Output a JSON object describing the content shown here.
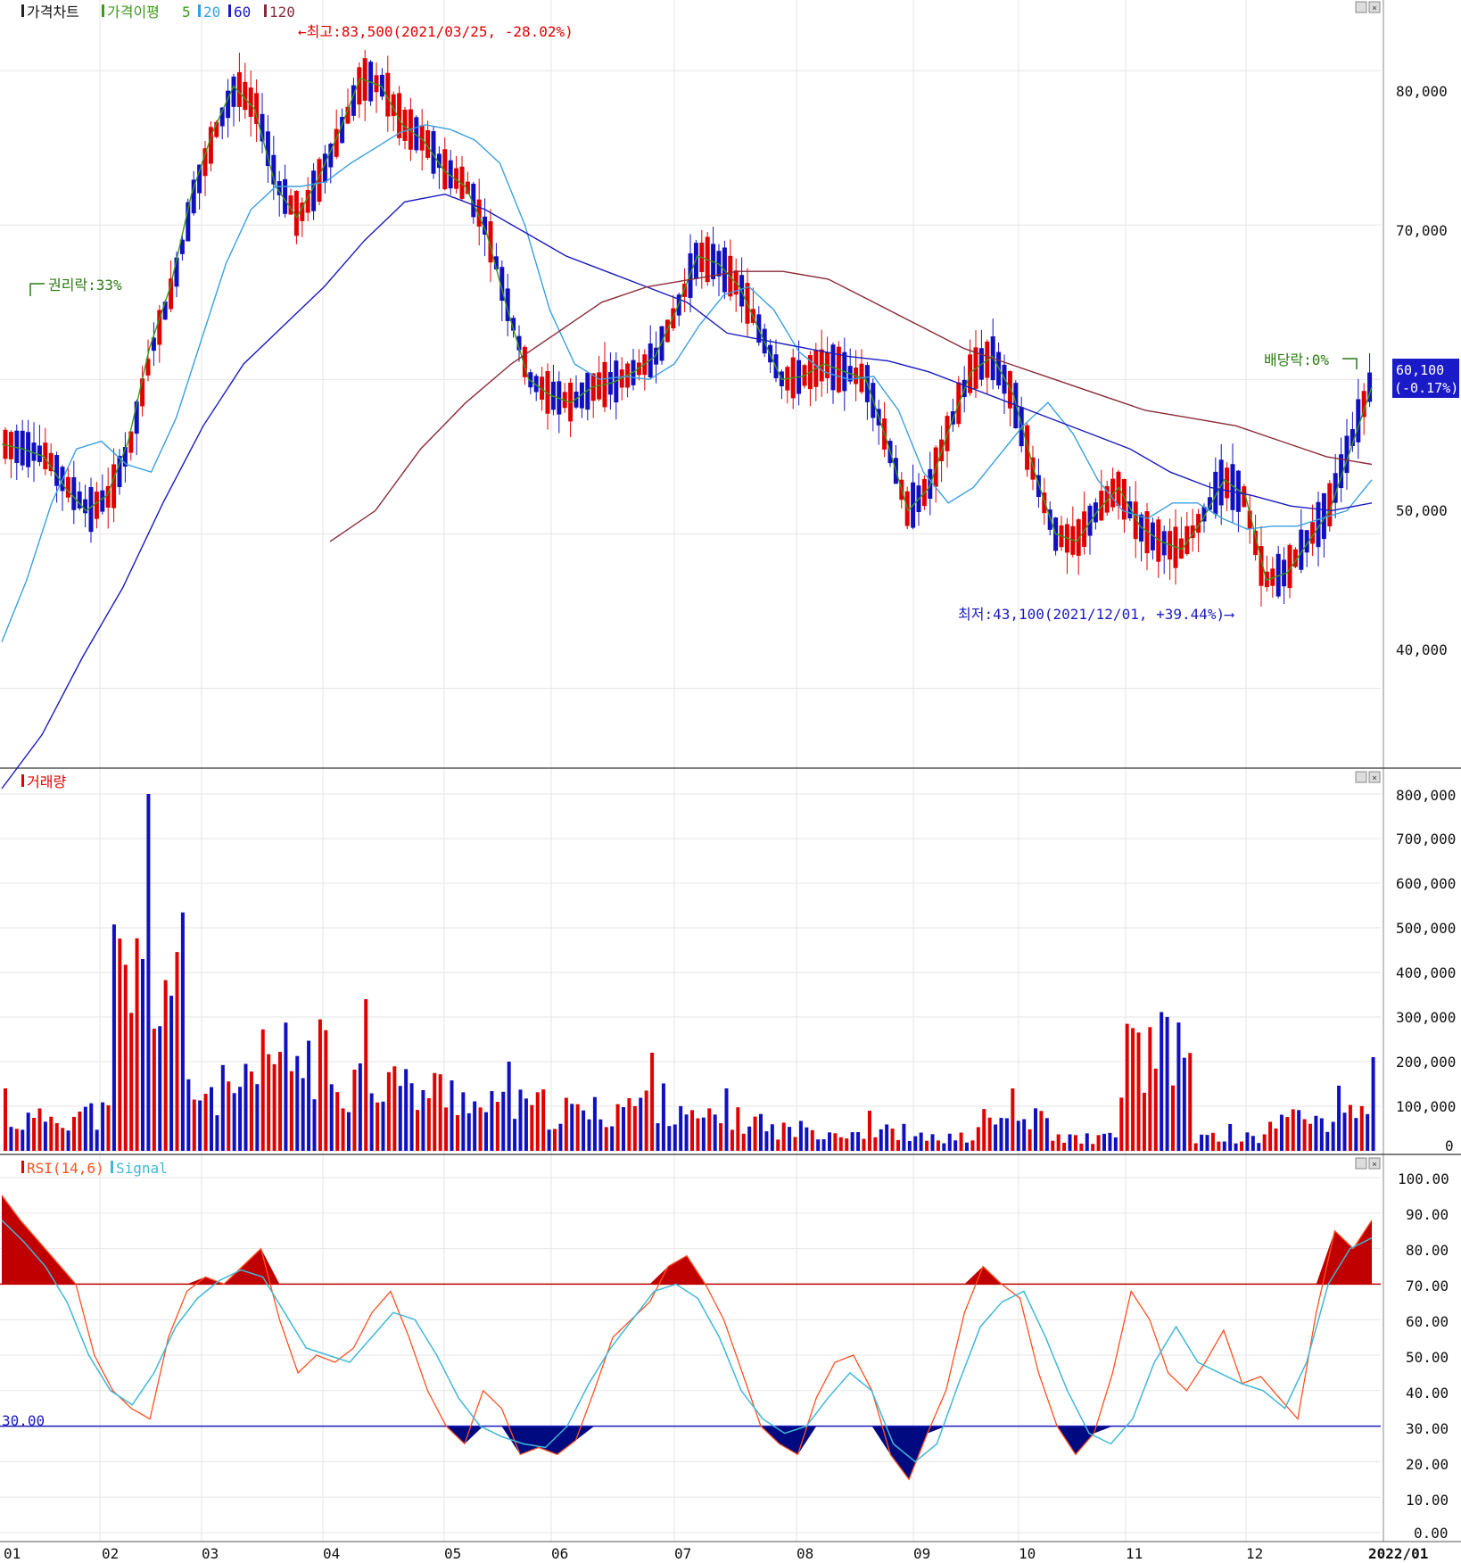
{
  "panels": {
    "price": {
      "legend": [
        "가격차트",
        "가격이평",
        "5",
        "20",
        "60",
        "120"
      ],
      "yticks": [
        "80,000",
        "70,000",
        "50,000",
        "40,000"
      ],
      "annotations": {
        "high": "←최고:83,500(2021/03/25, -28.02%)",
        "low": "최저:43,100(2021/12/01, +39.44%)⟶",
        "rights": "권리락:33%",
        "dividend": "배당락:0%"
      },
      "last_price": "60,100",
      "last_change": "(-0.17%)"
    },
    "volume": {
      "legend": "거래량",
      "yticks": [
        "800,000",
        "700,000",
        "600,000",
        "500,000",
        "400,000",
        "300,000",
        "200,000",
        "100,000",
        "0"
      ]
    },
    "rsi": {
      "legend": [
        "RSI(14,6)",
        "Signal"
      ],
      "yticks": [
        "100.00",
        "90.00",
        "80.00",
        "70.00",
        "60.00",
        "50.00",
        "40.00",
        "30.00",
        "20.00",
        "10.00",
        "0.00"
      ],
      "baseline_label": "30.00"
    }
  },
  "xaxis": {
    "labels": [
      "01",
      "02",
      "03",
      "04",
      "05",
      "06",
      "07",
      "08",
      "09",
      "10",
      "11",
      "12",
      "2022/01"
    ]
  },
  "colors": {
    "up": "#e00000",
    "down": "#1010c0",
    "ma5": "#3a9a1a",
    "ma20": "#3aa0e0",
    "ma60": "#1a1ac0",
    "ma120": "#8a2a3a",
    "grid": "#e6e6e6",
    "rsi": "#ff5020",
    "signal": "#40b8d8"
  },
  "chart_data": [
    {
      "type": "candlestick",
      "title": "가격차트",
      "series": [
        {
          "name": "5",
          "values": [
            55800,
            55500,
            55000,
            53000,
            51500,
            52500,
            56000,
            62000,
            66000,
            72000,
            76000,
            79000,
            77500,
            72500,
            70500,
            73000,
            76000,
            79500,
            79000,
            76500,
            75500,
            73500,
            72500,
            69500,
            64500,
            60000,
            59000,
            58500,
            59500,
            59800,
            60500,
            61500,
            64500,
            68000,
            67500,
            66000,
            63000,
            60000,
            60200,
            61000,
            60500,
            60000,
            56000,
            51500,
            53000,
            57000,
            60500,
            61500,
            59000,
            54000,
            50000,
            49500,
            51500,
            53000,
            50500,
            49500,
            49000,
            51000,
            53500,
            52500,
            47000,
            47500,
            49500,
            51500,
            55500,
            59500
          ]
        },
        {
          "name": "20",
          "values": [
            43000,
            47000,
            52000,
            55500,
            56000,
            54500,
            54000,
            57500,
            62500,
            67500,
            71000,
            72500,
            72500,
            72800,
            74000,
            75000,
            76000,
            76500,
            76200,
            75500,
            74000,
            70000,
            64500,
            61000,
            60000,
            60200,
            60000,
            61000,
            63500,
            65500,
            66000,
            64500,
            61800,
            60500,
            60000,
            60200,
            58000,
            54000,
            52000,
            53000,
            55000,
            57000,
            58500,
            56500,
            53500,
            51500,
            51000,
            52000,
            52000,
            51000,
            50300,
            50500,
            50500,
            51000,
            51500,
            53500
          ]
        },
        {
          "name": "60",
          "values": [
            33500,
            37000,
            42000,
            46500,
            52000,
            57000,
            61000,
            63500,
            66000,
            69000,
            71500,
            72000,
            71000,
            69500,
            68000,
            67000,
            66000,
            65000,
            63000,
            62500,
            62000,
            61500,
            61200,
            60500,
            59500,
            58500,
            57500,
            56500,
            55500,
            54000,
            53000,
            52500,
            51800,
            51500,
            52000
          ]
        },
        {
          "name": "120",
          "values": [
            49500,
            51500,
            55500,
            58500,
            61000,
            63000,
            65000,
            66000,
            66500,
            67000,
            67000,
            66500,
            65000,
            63500,
            62000,
            61000,
            60000,
            59000,
            58000,
            57500,
            57000,
            56000,
            55000,
            54500
          ]
        }
      ],
      "ylim": [
        35000,
        84000
      ]
    },
    {
      "type": "bar",
      "title": "거래량",
      "categories": [
        "01",
        "02",
        "03",
        "04",
        "05",
        "06",
        "07",
        "08",
        "09",
        "10",
        "11",
        "12",
        "2022/01"
      ],
      "values": [
        140000,
        170000,
        800000,
        280000,
        430000,
        340000,
        280000,
        200000,
        180000,
        220000,
        140000,
        100000,
        90000,
        60000,
        140000,
        60000,
        450000,
        60000,
        150000,
        210000
      ],
      "ylim": [
        0,
        800000
      ]
    },
    {
      "type": "line",
      "title": "RSI(14,6)",
      "series": [
        {
          "name": "RSI(14,6)",
          "values": [
            95,
            88,
            82,
            76,
            70,
            50,
            40,
            35,
            32,
            55,
            68,
            72,
            70,
            75,
            80,
            60,
            45,
            50,
            48,
            52,
            62,
            68,
            55,
            40,
            30,
            25,
            40,
            35,
            22,
            24,
            22,
            26,
            40,
            55,
            60,
            65,
            75,
            78,
            70,
            60,
            45,
            30,
            25,
            22,
            38,
            48,
            50,
            40,
            22,
            15,
            28,
            40,
            62,
            75,
            70,
            66,
            45,
            30,
            22,
            28,
            45,
            68,
            60,
            45,
            40,
            48,
            57,
            42,
            44,
            38,
            32,
            62,
            85,
            80,
            88
          ]
        },
        {
          "name": "Signal",
          "values": [
            88,
            82,
            75,
            65,
            50,
            40,
            36,
            45,
            58,
            66,
            71,
            74,
            72,
            62,
            52,
            50,
            48,
            55,
            62,
            60,
            50,
            38,
            30,
            27,
            25,
            24,
            30,
            42,
            52,
            60,
            68,
            70,
            66,
            55,
            40,
            32,
            28,
            30,
            38,
            45,
            40,
            25,
            20,
            25,
            42,
            58,
            65,
            68,
            55,
            40,
            28,
            25,
            32,
            48,
            58,
            48,
            45,
            42,
            40,
            35,
            48,
            70,
            80,
            83
          ]
        }
      ],
      "ylim": [
        0,
        100
      ]
    }
  ]
}
